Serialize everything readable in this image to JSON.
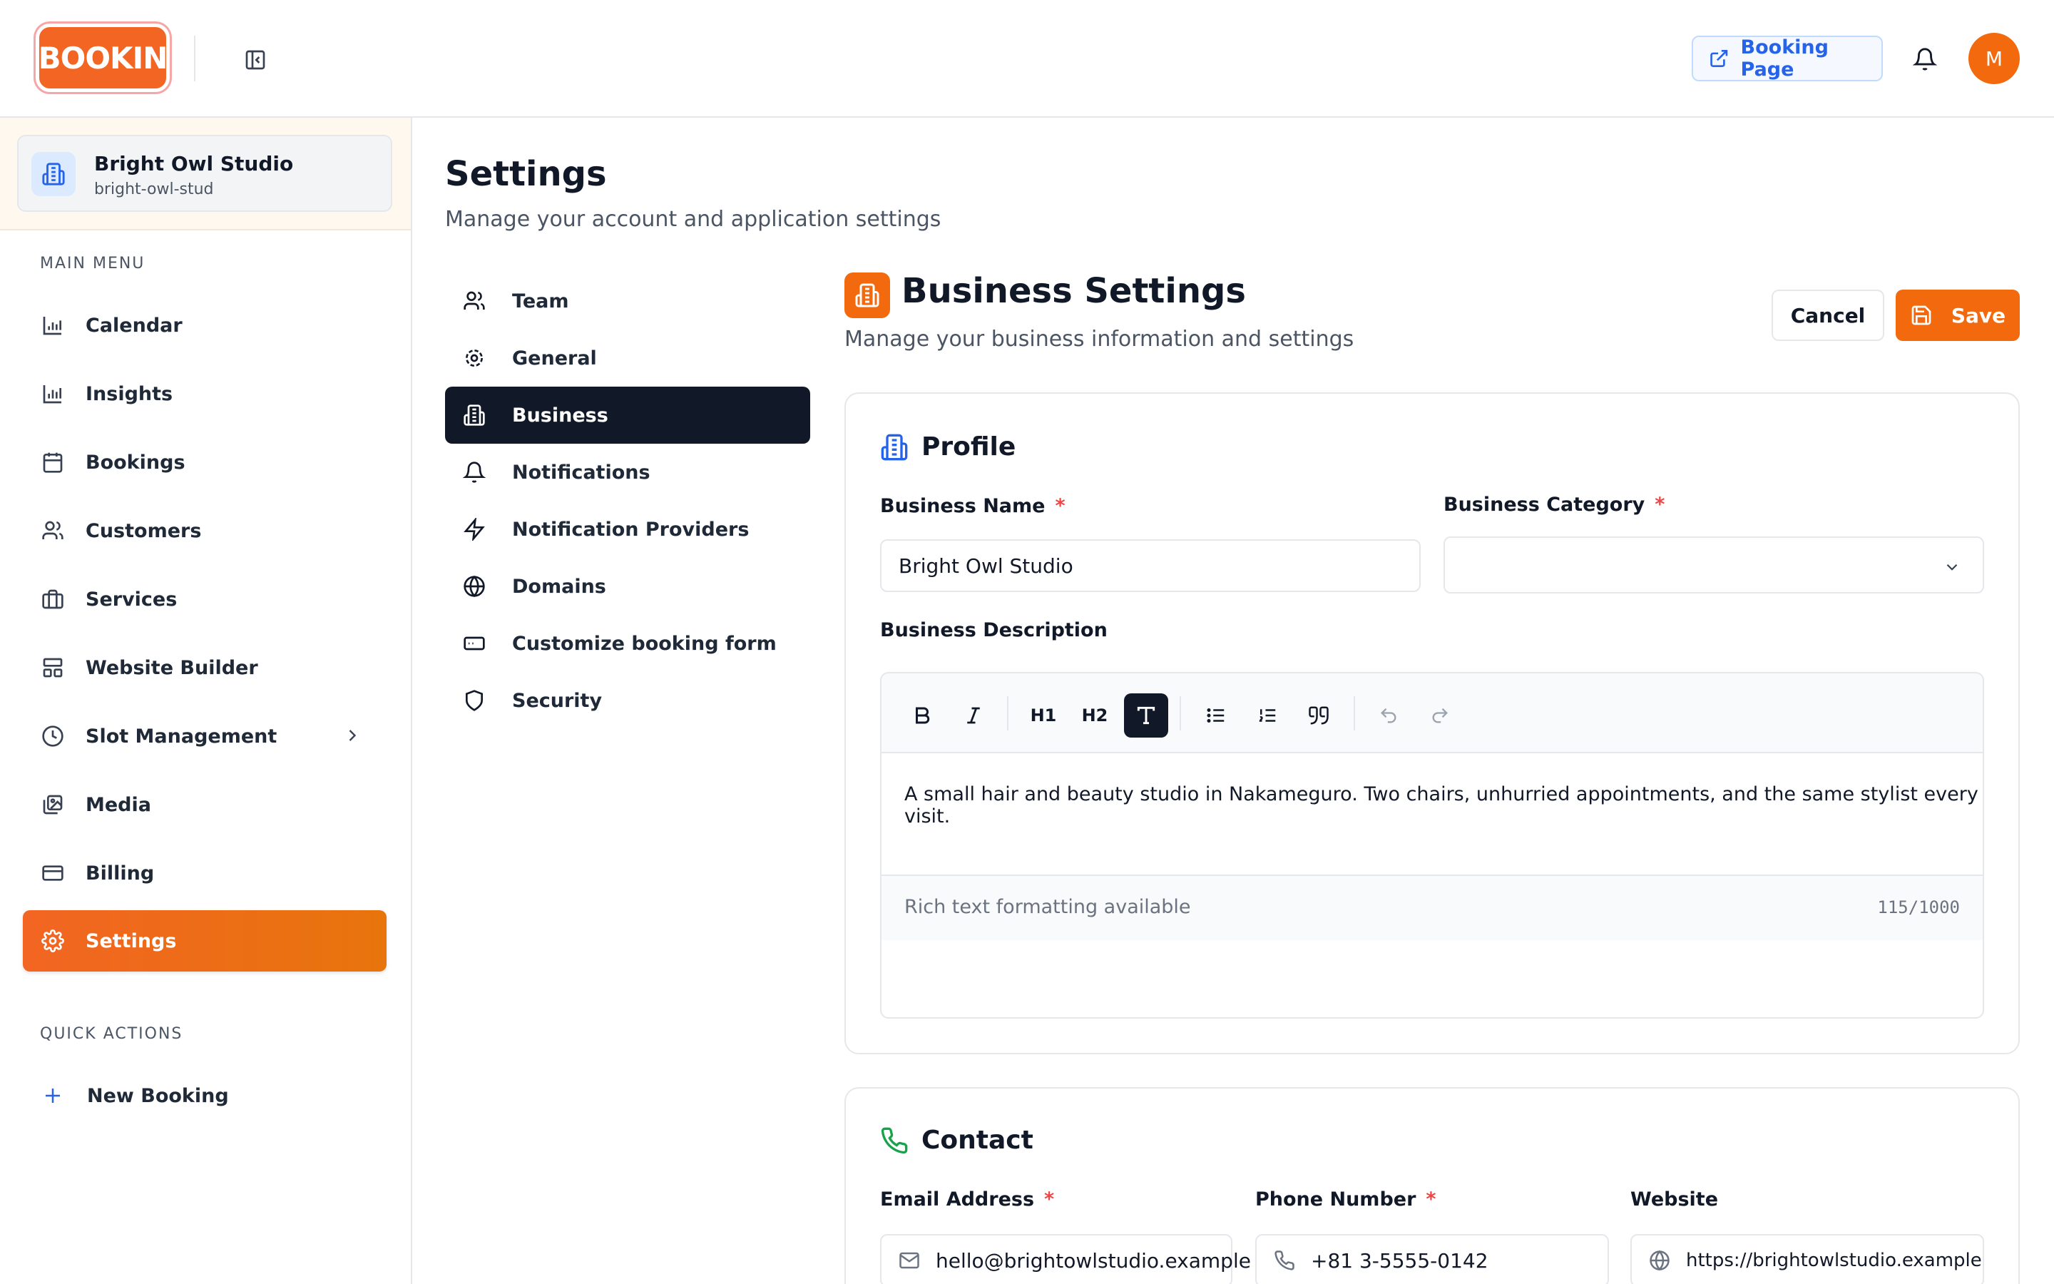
{
  "header": {
    "logo_text": "BOOKIN",
    "booking_page_label": "Booking Page",
    "avatar_initial": "M"
  },
  "sidebar": {
    "org": {
      "name": "Bright Owl Studio",
      "slug": "bright-owl-stud"
    },
    "main_menu_label": "MAIN MENU",
    "items": [
      {
        "label": "Calendar",
        "icon": "bar-chart-icon"
      },
      {
        "label": "Insights",
        "icon": "bar-chart-icon"
      },
      {
        "label": "Bookings",
        "icon": "calendar-icon"
      },
      {
        "label": "Customers",
        "icon": "users-icon"
      },
      {
        "label": "Services",
        "icon": "briefcase-icon"
      },
      {
        "label": "Website Builder",
        "icon": "layout-icon"
      },
      {
        "label": "Slot Management",
        "icon": "clock-icon"
      },
      {
        "label": "Media",
        "icon": "images-icon"
      },
      {
        "label": "Billing",
        "icon": "credit-card-icon"
      },
      {
        "label": "Settings",
        "icon": "gear-icon",
        "active": true
      }
    ],
    "quick_actions_label": "QUICK ACTIONS",
    "new_booking_label": "New Booking"
  },
  "page": {
    "title": "Settings",
    "subtitle": "Manage your account and application settings"
  },
  "settings_nav": [
    {
      "label": "Team",
      "icon": "users-icon"
    },
    {
      "label": "General",
      "icon": "gear-icon"
    },
    {
      "label": "Business",
      "icon": "building-icon",
      "active": true
    },
    {
      "label": "Notifications",
      "icon": "bell-icon"
    },
    {
      "label": "Notification Providers",
      "icon": "zap-icon"
    },
    {
      "label": "Domains",
      "icon": "globe-icon"
    },
    {
      "label": "Customize booking form",
      "icon": "form-icon"
    },
    {
      "label": "Security",
      "icon": "shield-icon"
    }
  ],
  "business": {
    "title": "Business Settings",
    "subtitle": "Manage your business information and settings",
    "cancel_label": "Cancel",
    "save_label": "Save"
  },
  "profile": {
    "title": "Profile",
    "business_name_label": "Business Name",
    "business_name_value": "Bright Owl Studio",
    "business_category_label": "Business Category",
    "business_category_value": "",
    "description_label": "Business Description",
    "description_text": "A small hair and beauty studio in Nakameguro. Two chairs, unhurried appointments, and the same stylist every visit.",
    "toolbar": {
      "h1": "H1",
      "h2": "H2"
    },
    "rich_text_hint": "Rich text formatting available",
    "char_count": "115/1000"
  },
  "contact": {
    "title": "Contact",
    "email_label": "Email Address",
    "email_value": "hello@brightowlstudio.example",
    "phone_label": "Phone Number",
    "phone_value": "+81 3-5555-0142",
    "website_label": "Website",
    "website_value": "https://brightowlstudio.example"
  },
  "required_marker": "*",
  "colors": {
    "brand_orange": "#f26a0d",
    "accent_blue": "#2563eb",
    "dark": "#111827",
    "required_red": "#ef4444",
    "contact_green": "#16a34a"
  }
}
